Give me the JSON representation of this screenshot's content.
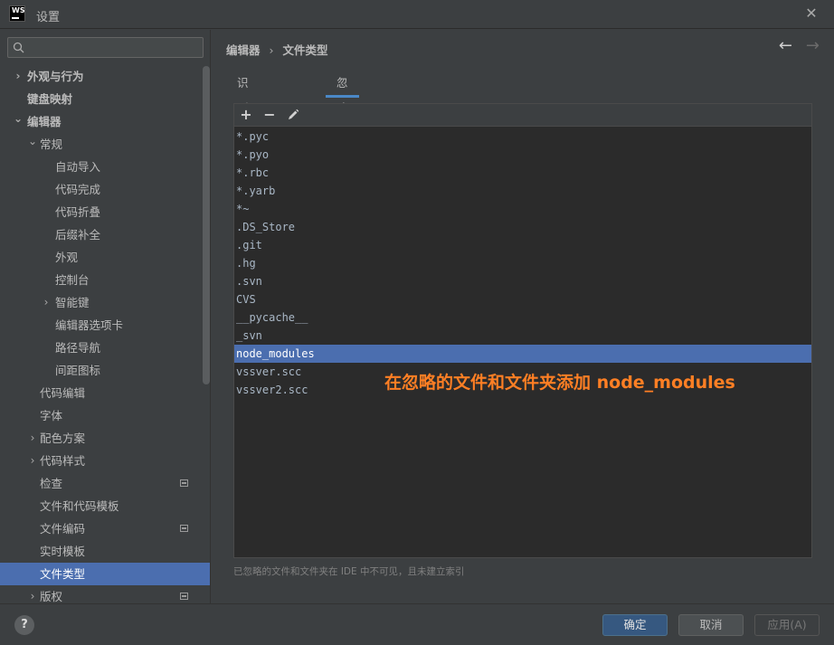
{
  "window": {
    "title": "设置",
    "logo_text": "WS"
  },
  "search": {
    "value": "",
    "placeholder": ""
  },
  "sidebar": {
    "items": [
      {
        "label": "外观与行为",
        "level": 0,
        "expandable": "collapsed",
        "bold": true
      },
      {
        "label": "键盘映射",
        "level": 0,
        "expandable": "none",
        "bold": true
      },
      {
        "label": "编辑器",
        "level": 0,
        "expandable": "expanded",
        "bold": true
      },
      {
        "label": "常规",
        "level": 1,
        "expandable": "expanded"
      },
      {
        "label": "自动导入",
        "level": 2,
        "expandable": "none"
      },
      {
        "label": "代码完成",
        "level": 2,
        "expandable": "none"
      },
      {
        "label": "代码折叠",
        "level": 2,
        "expandable": "none"
      },
      {
        "label": "后缀补全",
        "level": 2,
        "expandable": "none"
      },
      {
        "label": "外观",
        "level": 2,
        "expandable": "none"
      },
      {
        "label": "控制台",
        "level": 2,
        "expandable": "none"
      },
      {
        "label": "智能键",
        "level": 2,
        "expandable": "collapsed"
      },
      {
        "label": "编辑器选项卡",
        "level": 2,
        "expandable": "none"
      },
      {
        "label": "路径导航",
        "level": 2,
        "expandable": "none"
      },
      {
        "label": "间距图标",
        "level": 2,
        "expandable": "none"
      },
      {
        "label": "代码编辑",
        "level": 1,
        "expandable": "none"
      },
      {
        "label": "字体",
        "level": 1,
        "expandable": "none"
      },
      {
        "label": "配色方案",
        "level": 1,
        "expandable": "collapsed"
      },
      {
        "label": "代码样式",
        "level": 1,
        "expandable": "collapsed"
      },
      {
        "label": "检查",
        "level": 1,
        "expandable": "none",
        "project_icon": true
      },
      {
        "label": "文件和代码模板",
        "level": 1,
        "expandable": "none"
      },
      {
        "label": "文件编码",
        "level": 1,
        "expandable": "none",
        "project_icon": true
      },
      {
        "label": "实时模板",
        "level": 1,
        "expandable": "none"
      },
      {
        "label": "文件类型",
        "level": 1,
        "expandable": "none",
        "selected": true
      },
      {
        "label": "版权",
        "level": 1,
        "expandable": "collapsed",
        "project_icon": true
      }
    ]
  },
  "breadcrumb": {
    "parent": "编辑器",
    "separator": "›",
    "current": "文件类型"
  },
  "nav": {
    "back_icon": "arrow-left-icon",
    "forward_icon": "arrow-right-icon"
  },
  "tabs": [
    {
      "label": "识别的文件类型",
      "active": false
    },
    {
      "label": "忽略的文件和文件夹",
      "active": true
    }
  ],
  "toolbar": {
    "add_icon": "plus-icon",
    "remove_icon": "minus-icon",
    "edit_icon": "pencil-icon"
  },
  "ignored_list": [
    "*.pyc",
    "*.pyo",
    "*.rbc",
    "*.yarb",
    "*~",
    ".DS_Store",
    ".git",
    ".hg",
    ".svn",
    "CVS",
    "__pycache__",
    "_svn",
    "node_modules",
    "vssver.scc",
    "vssver2.scc"
  ],
  "selected_row": "node_modules",
  "annotation": "在忽略的文件和文件夹添加 node_modules",
  "footnote": "已忽略的文件和文件夹在 IDE 中不可见，且未建立索引",
  "buttons": {
    "help": "?",
    "ok": "确定",
    "cancel": "取消",
    "apply": "应用(A)"
  },
  "colors": {
    "accent": "#4b6eaf",
    "annotation": "#ff7f24",
    "background": "#3c3f41",
    "list_bg": "#2b2b2b"
  }
}
